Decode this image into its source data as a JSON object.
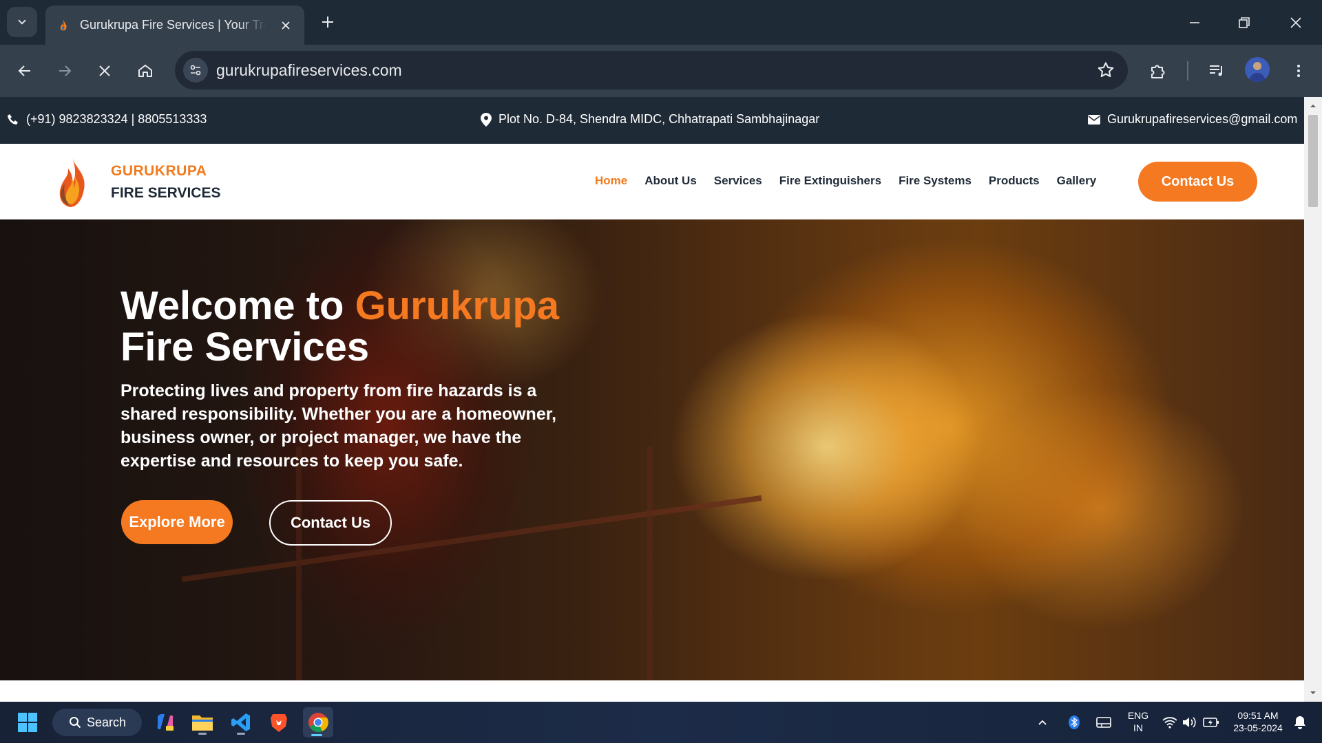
{
  "browser": {
    "tab_title": "Gurukrupa Fire Services | Your Trus",
    "url": "gurukrupafireservices.com"
  },
  "topbar": {
    "phone": "(+91) 9823823324 | 8805513333",
    "address": "Plot No. D-84, Shendra MIDC, Chhatrapati Sambhajinagar",
    "email": "Gurukrupafireservices@gmail.com"
  },
  "brand": {
    "line1": "GURUKRUPA",
    "line2": "FIRE SERVICES"
  },
  "nav": {
    "items": [
      {
        "label": "Home"
      },
      {
        "label": "About Us"
      },
      {
        "label": "Services"
      },
      {
        "label": "Fire Extinguishers"
      },
      {
        "label": "Fire Systems"
      },
      {
        "label": "Products"
      },
      {
        "label": "Gallery"
      }
    ],
    "cta": "Contact Us"
  },
  "hero": {
    "title_prefix": "Welcome to ",
    "title_accent": "Gurukrupa",
    "title_line2": "Fire Services",
    "description": "Protecting lives and property from fire hazards is a shared responsibility. Whether you are a homeowner, business owner, or project manager, we have the expertise and resources to keep you safe.",
    "primary_button": "Explore More",
    "secondary_button": "Contact Us"
  },
  "taskbar": {
    "search_label": "Search",
    "language_line1": "ENG",
    "language_line2": "IN",
    "time": "09:51 AM",
    "date": "23-05-2024"
  },
  "colors": {
    "accent": "#f47920",
    "dark": "#1f2a37"
  }
}
